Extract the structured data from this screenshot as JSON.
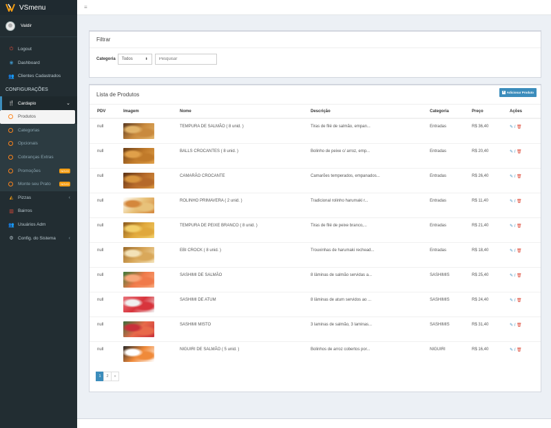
{
  "app": {
    "brand": "VSmenu",
    "user": "Valdir"
  },
  "sidebar": {
    "logout": "Logout",
    "dashboard": "Dashboard",
    "clients": "Clientes Cadastrados",
    "config_header": "CONFIGURAÇÕES",
    "cardapio": "Cardapio",
    "produtos": "Produtos",
    "categorias": "Categorias",
    "opcionais": "Opcionais",
    "cobrancas": "Cobranças Extras",
    "promocoes": "Promoções",
    "monte": "Monte seu Prato",
    "new_badge": "NOVO",
    "pizzas": "Pizzas",
    "bairros": "Bairros",
    "usuarios": "Usuários Adm",
    "config_sistema": "Config. do Sistema"
  },
  "filter": {
    "title": "Filtrar",
    "category_label": "Categoria",
    "category_value": "Todos",
    "search_placeholder": "Pesquisar"
  },
  "list": {
    "title": "Lista de Produtos",
    "add_button": "Adicionar Produto",
    "columns": [
      "PDV",
      "Imagem",
      "Nome",
      "Descrição",
      "Categoria",
      "Preço",
      "Ações"
    ],
    "rows": [
      {
        "pdv": "null",
        "name": "TEMPURA DE SALMÃO ( 8 unid. )",
        "desc": "Tiras de filé de salmão, empan...",
        "cat": "Entradas",
        "price": "R$ 36,40",
        "img_colors": [
          "#c98a3e",
          "#e2b46a",
          "#5a3a22"
        ]
      },
      {
        "pdv": "null",
        "name": "BALLS CROCANTES ( 8 unid. )",
        "desc": "Bolinho de peixe c/ arroz, emp...",
        "cat": "Entradas",
        "price": "R$ 20,40",
        "img_colors": [
          "#c07a2a",
          "#e0a04a",
          "#6b3f18"
        ]
      },
      {
        "pdv": "null",
        "name": "CAMARÃO CROCANTE",
        "desc": "Camarões temperados, empanados...",
        "cat": "Entradas",
        "price": "R$ 26,40",
        "img_colors": [
          "#b5692a",
          "#d8953f",
          "#5b3215"
        ]
      },
      {
        "pdv": "null",
        "name": "ROLINHO PRIMAVERA ( 2 unid. )",
        "desc": "Tradicional rolinho harumaki r...",
        "cat": "Entradas",
        "price": "R$ 11,40",
        "img_colors": [
          "#e8c27a",
          "#d4873c",
          "#ffffff"
        ]
      },
      {
        "pdv": "null",
        "name": "TEMPURA DE PEIXE BRANCO ( 8 unid. )",
        "desc": "Tiras de filé de peixe branco,...",
        "cat": "Entradas",
        "price": "R$ 21,40",
        "img_colors": [
          "#e0a83c",
          "#f2cf6a",
          "#8a5a1e"
        ]
      },
      {
        "pdv": "null",
        "name": "EBI CROCK ( 8 unid. )",
        "desc": "Trouxinhas de harumaki rechead...",
        "cat": "Entradas",
        "price": "R$ 18,40",
        "img_colors": [
          "#d9a85a",
          "#f3e2b8",
          "#9b6a2a"
        ]
      },
      {
        "pdv": "null",
        "name": "SASHIMI DE SALMÃO",
        "desc": "8 lâminas de salmão servidas a...",
        "cat": "SASHIMIS",
        "price": "R$ 25,40",
        "img_colors": [
          "#f07a4a",
          "#f7a77a",
          "#3a7a3a"
        ]
      },
      {
        "pdv": "null",
        "name": "SASHIMI DE ATUM",
        "desc": "8 lâminas de atum servidos ao ...",
        "cat": "SASHIMIS",
        "price": "R$ 24,40",
        "img_colors": [
          "#d8343c",
          "#f0f0f0",
          "#e8727a"
        ]
      },
      {
        "pdv": "null",
        "name": "SASHIMI MISTO",
        "desc": "3 laminas de salmão, 3 laminas...",
        "cat": "SASHIMIS",
        "price": "R$ 31,40",
        "img_colors": [
          "#e86a4a",
          "#c8303a",
          "#3a6a3a"
        ]
      },
      {
        "pdv": "null",
        "name": "NIGUIRI DE SALMÃO ( 5 unid. )",
        "desc": "Bolinhos de arroz cobertos por...",
        "cat": "NIGUIRI",
        "price": "R$ 16,40",
        "img_colors": [
          "#f08a3a",
          "#ffffff",
          "#2a2a2a"
        ]
      }
    ],
    "pages": [
      "1",
      "2",
      "»"
    ]
  }
}
